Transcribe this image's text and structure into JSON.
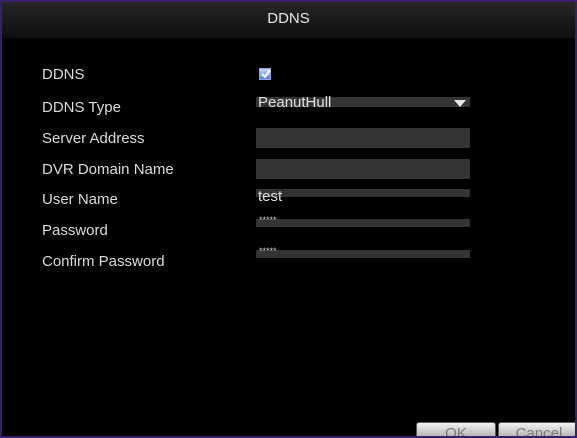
{
  "dialog": {
    "title": "DDNS"
  },
  "form": {
    "ddns": {
      "label": "DDNS",
      "checked": true
    },
    "ddns_type": {
      "label": "DDNS Type",
      "value": "PeanutHull"
    },
    "server_address": {
      "label": "Server Address",
      "value": ""
    },
    "dvr_domain_name": {
      "label": "DVR Domain Name",
      "value": ""
    },
    "user_name": {
      "label": "User Name",
      "value": "test"
    },
    "password": {
      "label": "Password",
      "value": "*****"
    },
    "confirm_password": {
      "label": "Confirm Password",
      "value": "*****"
    }
  },
  "buttons": {
    "ok": "OK",
    "cancel": "Cancel"
  },
  "icons": {
    "checkbox": "checkmark-icon",
    "dropdown": "chevron-down-icon"
  },
  "colors": {
    "frame_border": "#3a1e6e",
    "field_background": "#343434",
    "checkbox_fill": "#5a78d0"
  }
}
